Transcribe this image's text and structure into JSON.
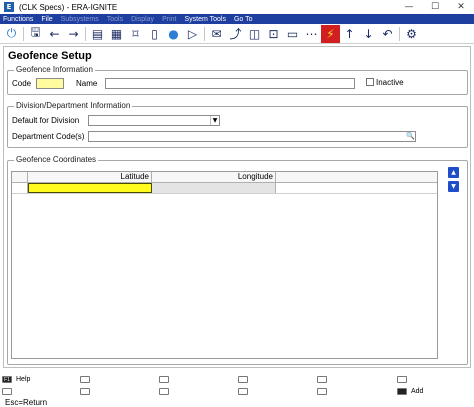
{
  "window": {
    "title": "(CLK Specs) - ERA-IGNITE",
    "minimize": "—",
    "maximize": "☐",
    "close": "✕"
  },
  "menu": [
    {
      "label": "Functions",
      "enabled": true
    },
    {
      "label": "File",
      "enabled": true
    },
    {
      "label": "Subsystems",
      "enabled": false
    },
    {
      "label": "Tools",
      "enabled": false
    },
    {
      "label": "Display",
      "enabled": false
    },
    {
      "label": "Print",
      "enabled": false
    },
    {
      "label": "System Tools",
      "enabled": true
    },
    {
      "label": "Go To",
      "enabled": true
    }
  ],
  "toolbar": {
    "icons": [
      "power-icon",
      "save-icon",
      "back-arrow-icon",
      "forward-arrow-icon",
      "notes-icon",
      "calendar-icon",
      "bookmark-icon",
      "document-icon",
      "user-icon",
      "play-icon",
      "email-icon",
      "chart-icon",
      "message-icon",
      "inbox-icon",
      "chat-icon",
      "message-dots-icon",
      "launch-icon",
      "up-arrow-icon",
      "down-arrow-icon",
      "undo-icon",
      "settings-icon"
    ]
  },
  "page": {
    "title": "Geofence Setup",
    "geofence_info": {
      "legend": "Geofence Information",
      "code_label": "Code",
      "code_value": "",
      "name_label": "Name",
      "name_value": "",
      "inactive_label": "Inactive"
    },
    "division_info": {
      "legend": "Division/Department Information",
      "default_division_label": "Default for Division",
      "default_division_value": "",
      "department_codes_label": "Department Code(s)",
      "department_codes_value": ""
    },
    "coordinates": {
      "legend": "Geofence Coordinates",
      "columns": [
        "Latitude",
        "Longitude",
        ""
      ],
      "rows": [
        [
          "",
          "",
          ""
        ]
      ]
    }
  },
  "footer": {
    "keys": [
      {
        "key": "F1",
        "label": "Help"
      },
      {
        "key": "F2",
        "label": ""
      },
      {
        "key": "F3",
        "label": ""
      },
      {
        "key": "F4",
        "label": ""
      },
      {
        "key": "F5",
        "label": ""
      },
      {
        "key": "F6",
        "label": ""
      },
      {
        "key": "F7",
        "label": ""
      },
      {
        "key": "F8",
        "label": ""
      },
      {
        "key": "F9",
        "label": ""
      },
      {
        "key": "F10",
        "label": "Add"
      },
      {
        "key": "F11",
        "label": ""
      },
      {
        "key": "F12",
        "label": ""
      }
    ],
    "status": "Esc=Return"
  },
  "colors": {
    "menubar": "#1f3fa0",
    "active_field": "#fffb9e",
    "active_cell": "#fffb1f",
    "scroll_button": "#1f4fc8",
    "launch_icon_bg": "#d11f1f"
  }
}
